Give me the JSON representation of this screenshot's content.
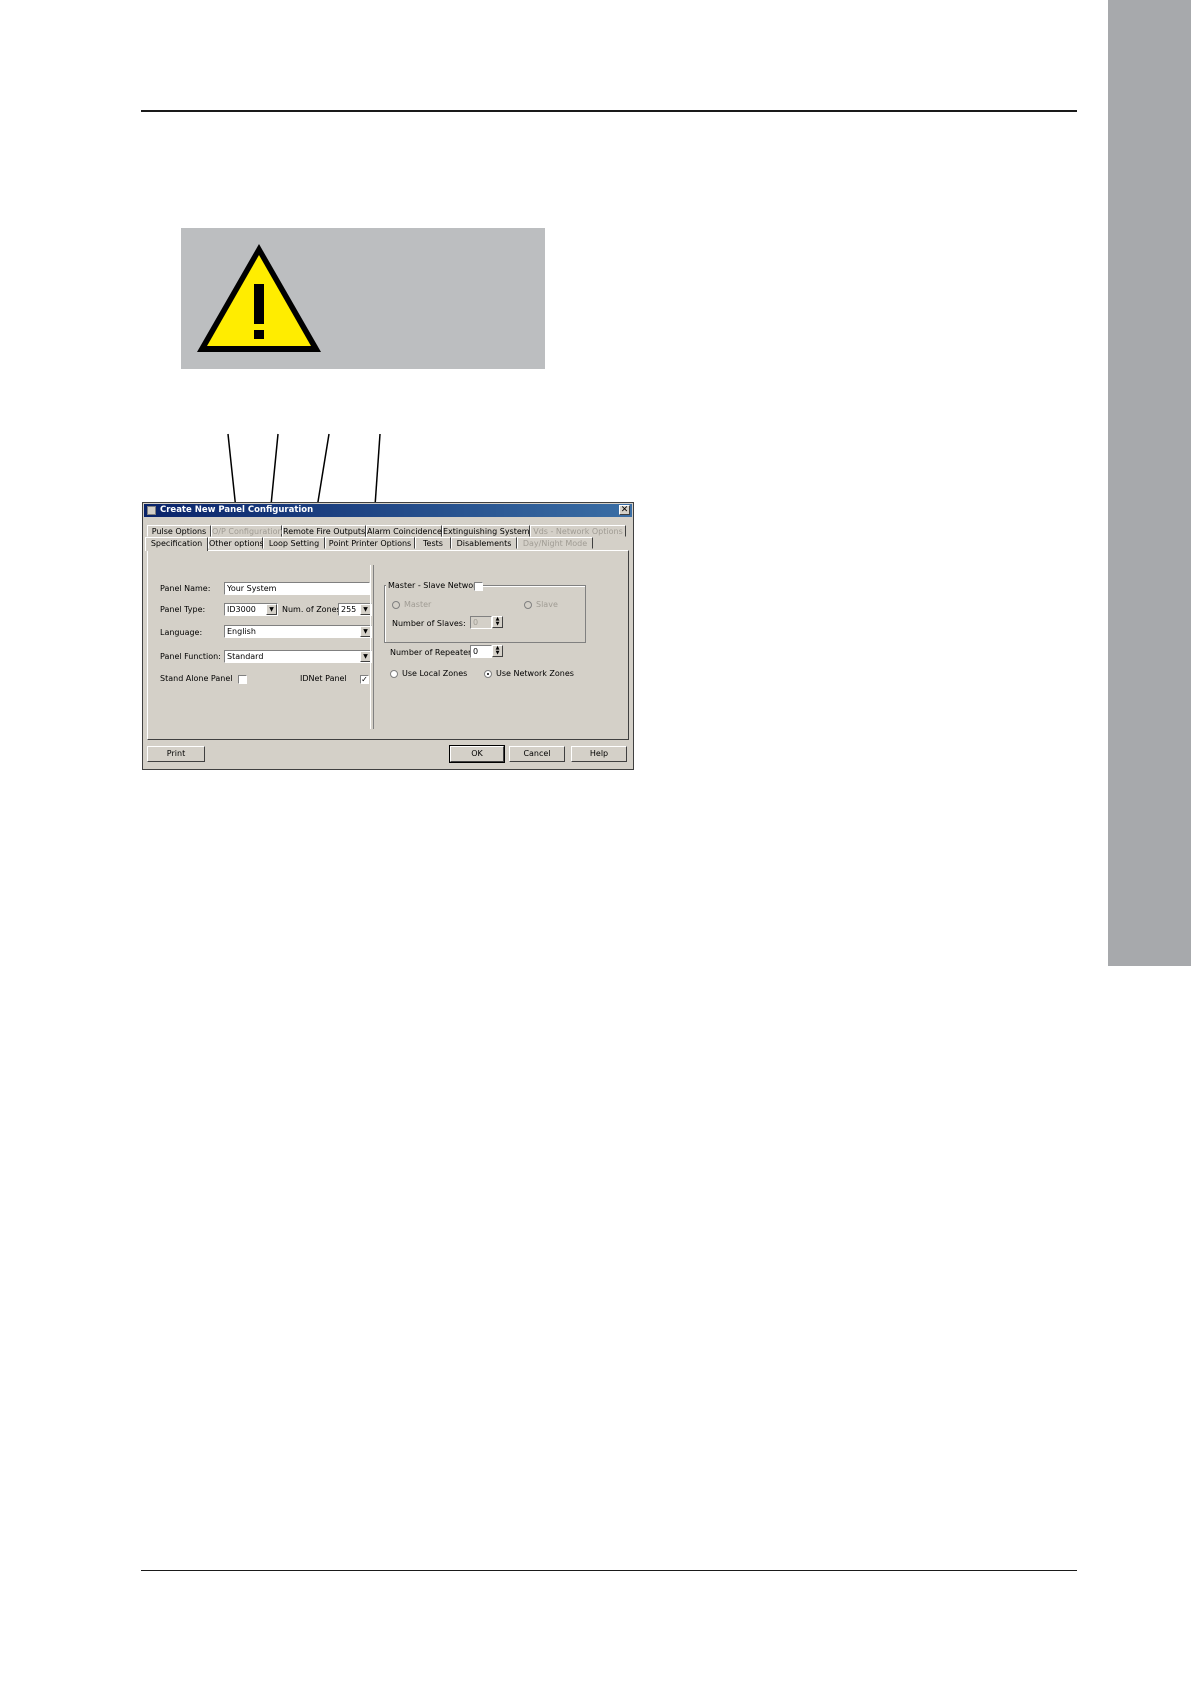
{
  "dialog": {
    "title": "Create New Panel Configuration",
    "close_glyph": "✕",
    "tabs_row1": [
      {
        "label": "Pulse Options",
        "disabled": false
      },
      {
        "label": "O/P Configuration",
        "disabled": true
      },
      {
        "label": "Remote Fire Outputs",
        "disabled": false
      },
      {
        "label": "Alarm Coincidence",
        "disabled": false
      },
      {
        "label": "Extinguishing System",
        "disabled": false
      },
      {
        "label": "Vds - Network Options",
        "disabled": true
      }
    ],
    "tabs_row2": [
      {
        "label": "Specification",
        "active": true
      },
      {
        "label": "Other options",
        "disabled": false
      },
      {
        "label": "Loop Setting",
        "disabled": false
      },
      {
        "label": "Point Printer Options",
        "disabled": false
      },
      {
        "label": "Tests",
        "disabled": false
      },
      {
        "label": "Disablements",
        "disabled": false
      },
      {
        "label": "Day/Night Mode",
        "disabled": true
      }
    ],
    "left": {
      "panel_name_label": "Panel Name:",
      "panel_name_value": "Your System",
      "panel_type_label": "Panel Type:",
      "panel_type_value": "ID3000",
      "num_zones_label": "Num. of Zones:",
      "num_zones_value": "255",
      "language_label": "Language:",
      "language_value": "English",
      "panel_function_label": "Panel Function:",
      "panel_function_value": "Standard",
      "stand_alone_label": "Stand Alone Panel",
      "stand_alone_checked": false,
      "idnet_label": "IDNet Panel",
      "idnet_checked": true
    },
    "right": {
      "network_label": "Master - Slave Network",
      "network_checked": false,
      "master_label": "Master",
      "slave_label": "Slave",
      "num_slaves_label": "Number of Slaves:",
      "num_slaves_value": "0",
      "num_repeaters_label": "Number of Repeaters:",
      "num_repeaters_value": "0",
      "use_local_zones_label": "Use Local Zones",
      "use_network_zones_label": "Use Network Zones",
      "selected_zone_option": "Use Network Zones"
    },
    "buttons": {
      "print": "Print",
      "ok": "OK",
      "cancel": "Cancel",
      "help": "Help"
    }
  },
  "icons": {
    "warning": "warning-triangle-icon",
    "dropdown": "▼",
    "check": "✓",
    "spin_up": "▲",
    "spin_down": "▼"
  },
  "colors": {
    "side_tab": "#a7a9ac",
    "warning_box": "#bcbec0",
    "warning_yellow": "#ffed00",
    "dialog_face": "#d4d0c8",
    "title_bar": "#0a246a"
  }
}
